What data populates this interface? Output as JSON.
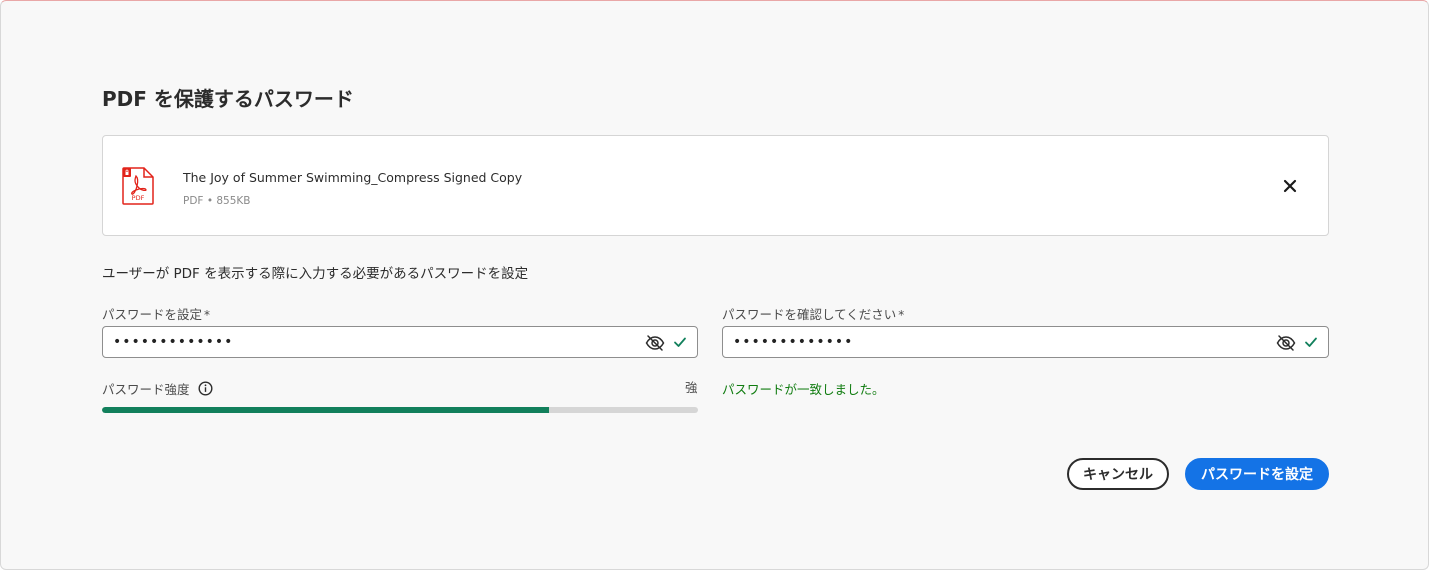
{
  "dialog": {
    "title": "PDF を保護するパスワード"
  },
  "file": {
    "name": "The Joy of Summer Swimming_Compress Signed Copy",
    "type": "PDF",
    "separator": "•",
    "size": "855KB",
    "icon_label": "PDF"
  },
  "instruction": "ユーザーが PDF を表示する際に入力する必要があるパスワードを設定",
  "password": {
    "label": "パスワードを設定",
    "required_mark": "*",
    "value": "•••••••••••••"
  },
  "confirm": {
    "label": "パスワードを確認してください",
    "required_mark": "*",
    "value": "•••••••••••••"
  },
  "strength": {
    "label": "パスワード強度",
    "value": "強",
    "fraction": 0.75
  },
  "match_message": "パスワードが一致しました。",
  "buttons": {
    "cancel": "キャンセル",
    "submit": "パスワードを設定"
  },
  "colors": {
    "accent": "#1473e6",
    "success": "#12805c",
    "match_text": "#107c10",
    "pdf_red": "#e2231a"
  },
  "icons": {
    "file": "pdf-file-icon",
    "close": "close-icon",
    "toggle_visibility": "eye-off-icon",
    "valid": "checkmark-icon",
    "info": "info-icon"
  }
}
